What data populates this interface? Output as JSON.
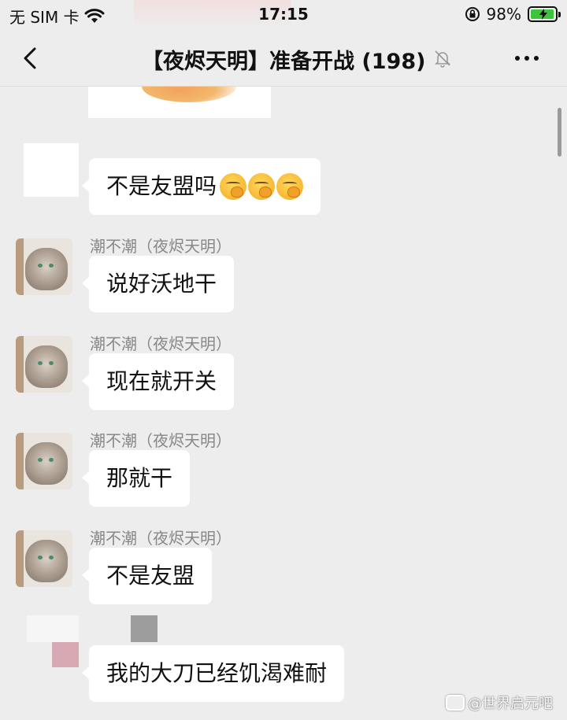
{
  "status_bar": {
    "carrier": "无 SIM 卡",
    "time": "17:15",
    "battery": "98%",
    "battery_level": 0.98
  },
  "nav": {
    "title": "【夜烬天明】准备开战 (198)"
  },
  "messages": [
    {
      "sender": "",
      "text": "不是友盟吗",
      "emoji_count": 3
    },
    {
      "sender": "潮不潮（夜烬天明）",
      "text": "说好沃地干"
    },
    {
      "sender": "潮不潮（夜烬天明）",
      "text": "现在就开关"
    },
    {
      "sender": "潮不潮（夜烬天明）",
      "text": "那就干"
    },
    {
      "sender": "潮不潮（夜烬天明）",
      "text": "不是友盟"
    },
    {
      "sender": "",
      "text": "我的大刀已经饥渴难耐"
    }
  ],
  "watermark": "@世界启元吧",
  "colors": {
    "background": "#ededed",
    "bubble": "#ffffff",
    "battery_green": "#3cc43c"
  }
}
